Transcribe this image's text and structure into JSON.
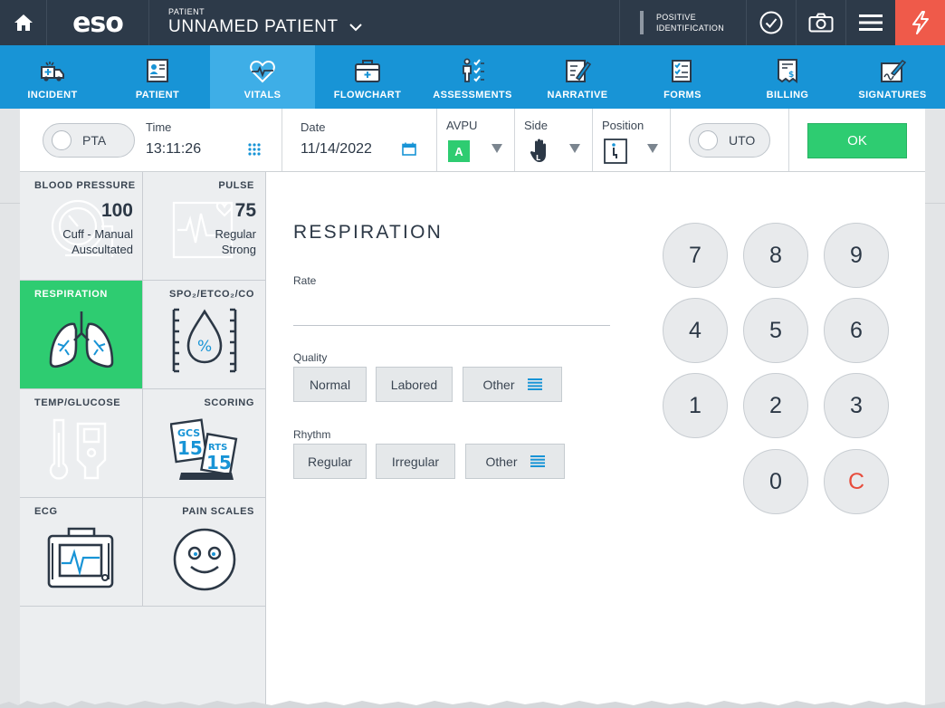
{
  "topbar": {
    "brand": "eso",
    "patient_label": "PATIENT",
    "patient_name": "UNNAMED PATIENT",
    "positive_id_line1": "POSITIVE",
    "positive_id_line2": "IDENTIFICATION"
  },
  "nav": {
    "items": [
      {
        "label": "INCIDENT",
        "icon": "ambulance-icon"
      },
      {
        "label": "PATIENT",
        "icon": "patient-card-icon"
      },
      {
        "label": "VITALS",
        "icon": "heart-pulse-icon",
        "active": true
      },
      {
        "label": "FLOWCHART",
        "icon": "medical-bag-icon"
      },
      {
        "label": "ASSESSMENTS",
        "icon": "person-checklist-icon"
      },
      {
        "label": "NARRATIVE",
        "icon": "document-pen-icon"
      },
      {
        "label": "FORMS",
        "icon": "checklist-icon"
      },
      {
        "label": "BILLING",
        "icon": "invoice-dollar-icon"
      },
      {
        "label": "SIGNATURES",
        "icon": "signature-icon"
      }
    ]
  },
  "controls": {
    "pta_label": "PTA",
    "time_label": "Time",
    "time_value": "13:11:26",
    "date_label": "Date",
    "date_value": "11/14/2022",
    "avpu_label": "AVPU",
    "avpu_value": "A",
    "side_label": "Side",
    "position_label": "Position",
    "uto_label": "UTO",
    "ok_label": "OK"
  },
  "tiles": {
    "blood_pressure": {
      "title": "BLOOD PRESSURE",
      "value": "100",
      "line1": "Cuff - Manual",
      "line2": "Auscultated"
    },
    "pulse": {
      "title": "PULSE",
      "value": "75",
      "line1": "Regular",
      "line2": "Strong"
    },
    "respiration": {
      "title": "RESPIRATION"
    },
    "spo2": {
      "title": "SPO₂/ETCO₂/CO"
    },
    "temp": {
      "title": "TEMP/GLUCOSE"
    },
    "scoring": {
      "title": "SCORING",
      "gcs_label": "GCS",
      "gcs_value": "15",
      "rts_label": "RTS",
      "rts_value": "15"
    },
    "ecg": {
      "title": "ECG"
    },
    "pain": {
      "title": "PAIN SCALES"
    }
  },
  "main": {
    "heading": "RESPIRATION",
    "rate_label": "Rate",
    "quality_label": "Quality",
    "quality_options": [
      "Normal",
      "Labored",
      "Other"
    ],
    "rhythm_label": "Rhythm",
    "rhythm_options": [
      "Regular",
      "Irregular",
      "Other"
    ]
  },
  "keypad": {
    "keys": [
      "7",
      "8",
      "9",
      "4",
      "5",
      "6",
      "1",
      "2",
      "3",
      "0",
      "C"
    ]
  },
  "colors": {
    "topbar": "#2d3a49",
    "nav": "#1894d6",
    "nav_active": "#3eaee7",
    "green": "#2ecc71",
    "alert": "#ef5a4a"
  }
}
